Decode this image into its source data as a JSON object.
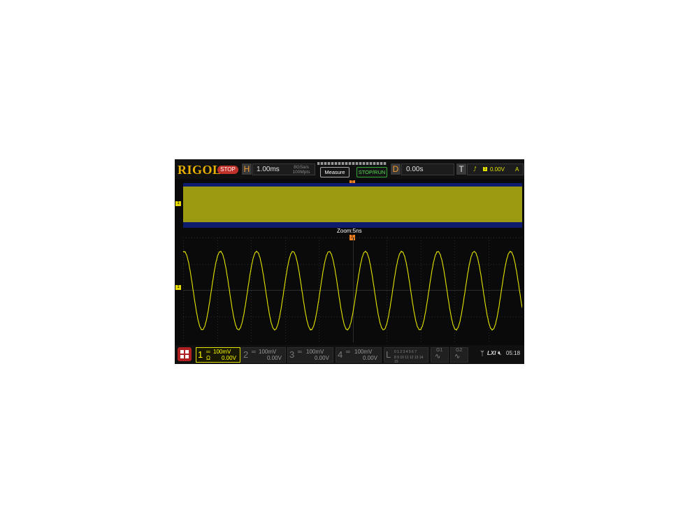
{
  "brand": "RIGOL",
  "run_status": "STOP",
  "horizontal": {
    "tag": "H",
    "timebase": "1.00ms",
    "sample_rate": "8GSa/s",
    "memory_depth": "100Mpts"
  },
  "buttons": {
    "measure": "Measure",
    "stop_run": "STOP/RUN"
  },
  "delay": {
    "tag": "D",
    "value": "0.00s"
  },
  "trigger": {
    "tag": "T",
    "source_icon": "rising-edge-icon",
    "level": "0.00V",
    "mode": "A"
  },
  "zoom_label": "Zoom:5ns",
  "channels": [
    {
      "num": "1",
      "scale": "100mV",
      "offset": "0.00V",
      "impedance": "Ω",
      "active": true
    },
    {
      "num": "2",
      "scale": "100mV",
      "offset": "0.00V",
      "active": false
    },
    {
      "num": "3",
      "scale": "100mV",
      "offset": "0.00V",
      "active": false
    },
    {
      "num": "4",
      "scale": "100mV",
      "offset": "0.00V",
      "active": false
    }
  ],
  "logic": {
    "tag": "L",
    "row1": "0 1 2 3  4 5 6 7",
    "row2": "8 9 10 11 12 13 14 15"
  },
  "generators": [
    "G1",
    "G2"
  ],
  "status": {
    "usb_icon": "usb-icon",
    "lxi": "LXI",
    "sound_icon": "mute-icon",
    "time": "05:18"
  },
  "colors": {
    "ch1": "#e5e500",
    "brand": "#e8b000",
    "stop": "#c0322a",
    "overview_bg": "#0f1c6e",
    "overview_fill": "#9b9a10",
    "trigger_marker": "#f08020"
  },
  "waveform": {
    "type": "sine",
    "visible_cycles": 9,
    "amplitude_divisions": 1.7
  }
}
